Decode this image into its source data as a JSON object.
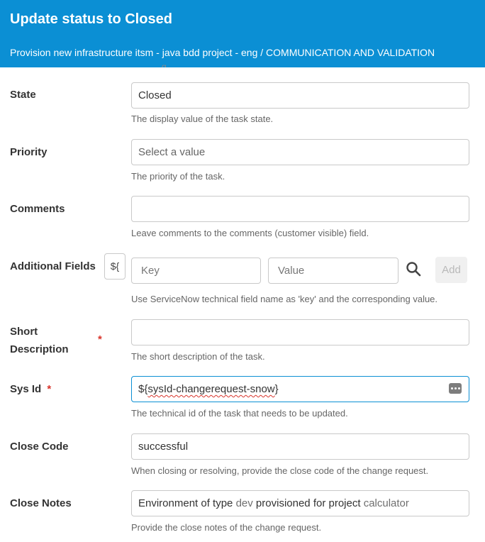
{
  "dialog": {
    "title": "Update status to Closed",
    "breadcrumb": "Provision new infrastructure itsm - java bdd project - eng / COMMUNICATION AND VALIDATION"
  },
  "fields": {
    "state": {
      "label": "State",
      "value": "Closed",
      "help": "The display value of the task state."
    },
    "priority": {
      "label": "Priority",
      "placeholder": "Select a value",
      "help": "The priority of the task."
    },
    "comments": {
      "label": "Comments",
      "value": "",
      "help": "Leave comments to the comments (customer visible) field."
    },
    "additional_fields": {
      "label": "Additional Fields",
      "var_button": "${",
      "key_placeholder": "Key",
      "value_placeholder": "Value",
      "add_label": "Add",
      "help": "Use ServiceNow technical field name as 'key' and the corresponding value."
    },
    "short_description": {
      "label_line1": "Short",
      "label_line2": "Description",
      "required_mark": "*",
      "value": "",
      "help": "The short description of the task."
    },
    "sys_id": {
      "label": "Sys Id",
      "required_mark": "*",
      "value_prefix": "${",
      "value_mid": "sysId-changerequest-snow",
      "value_suffix": "}",
      "help": "The technical id of the task that needs to be updated."
    },
    "close_code": {
      "label": "Close Code",
      "value": "successful",
      "help": "When closing or resolving, provide the close code of the change request."
    },
    "close_notes": {
      "label": "Close Notes",
      "value_parts": [
        "Environment of type ",
        "dev",
        " provisioned for project ",
        "calculator"
      ],
      "help": "Provide the close notes of the change request."
    }
  },
  "colors": {
    "header_bg": "#0b8fd4",
    "required": "#d9342b",
    "focus_border": "#0b8fd4"
  }
}
